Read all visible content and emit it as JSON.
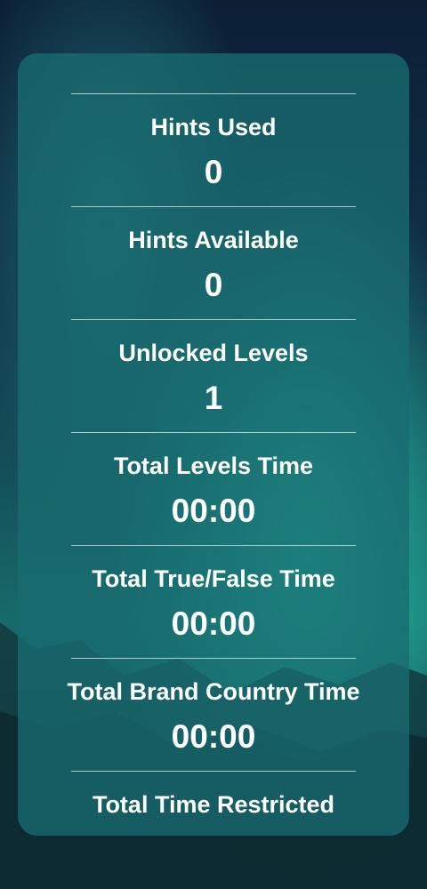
{
  "stats": [
    {
      "label": "Hints Used",
      "value": "0"
    },
    {
      "label": "Hints Available",
      "value": "0"
    },
    {
      "label": "Unlocked Levels",
      "value": "1"
    },
    {
      "label": "Total Levels Time",
      "value": "00:00"
    },
    {
      "label": "Total True/False Time",
      "value": "00:00"
    },
    {
      "label": "Total Brand Country Time",
      "value": "00:00"
    },
    {
      "label": "Total Time Restricted",
      "value": ""
    }
  ],
  "colors": {
    "panel": "#186c70",
    "text": "#ffffff",
    "divider": "#dcf0f0",
    "background_top": "#0e2438",
    "aurora": "#1fb5a0"
  }
}
